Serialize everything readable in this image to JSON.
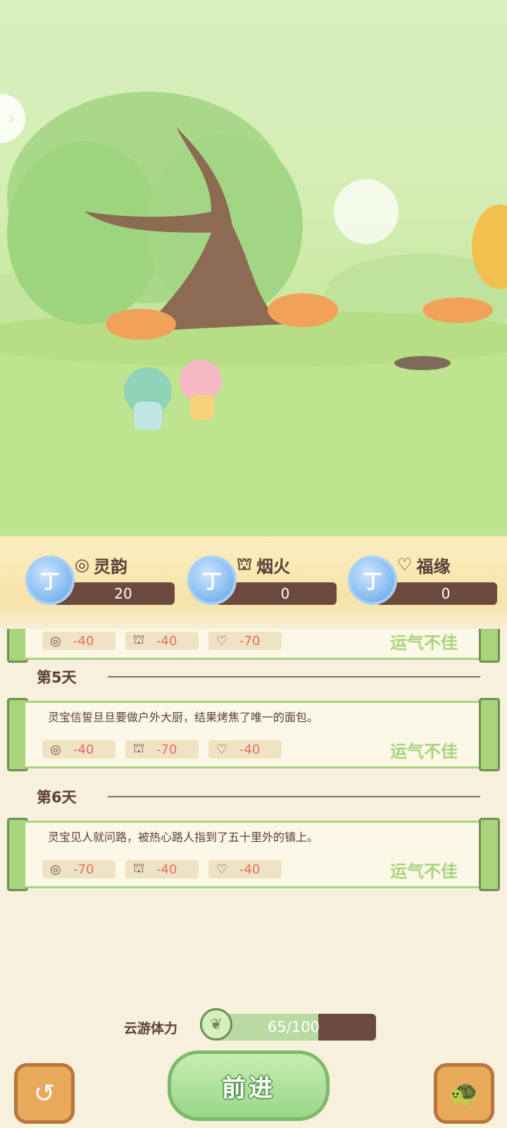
{
  "stats": [
    {
      "icon": "spiral-icon",
      "label": "灵韵",
      "value": "20"
    },
    {
      "icon": "mushroom-icon",
      "label": "烟火",
      "value": "0"
    },
    {
      "icon": "heart-icon",
      "label": "福缘",
      "value": "0"
    }
  ],
  "log": {
    "partial": {
      "chips": [
        "-40",
        "-40",
        "-70"
      ],
      "luck": "运气不佳"
    },
    "days": [
      {
        "title": "第5天",
        "text": "灵宝信誓旦旦要做户外大厨，结果烤焦了唯一的面包。",
        "chips": [
          "-40",
          "-70",
          "-40"
        ],
        "luck": "运气不佳"
      },
      {
        "title": "第6天",
        "text": "灵宝见人就问路，被热心路人指到了五十里外的镇上。",
        "chips": [
          "-70",
          "-40",
          "-40"
        ],
        "luck": "运气不佳"
      }
    ]
  },
  "energy": {
    "label": "云游体力",
    "text": "65/100",
    "current": 65,
    "max": 100
  },
  "buttons": {
    "go": "前进"
  },
  "colors": {
    "accent": "#a9d47b",
    "brown": "#6d4a40",
    "negative": "#e56a6a"
  }
}
